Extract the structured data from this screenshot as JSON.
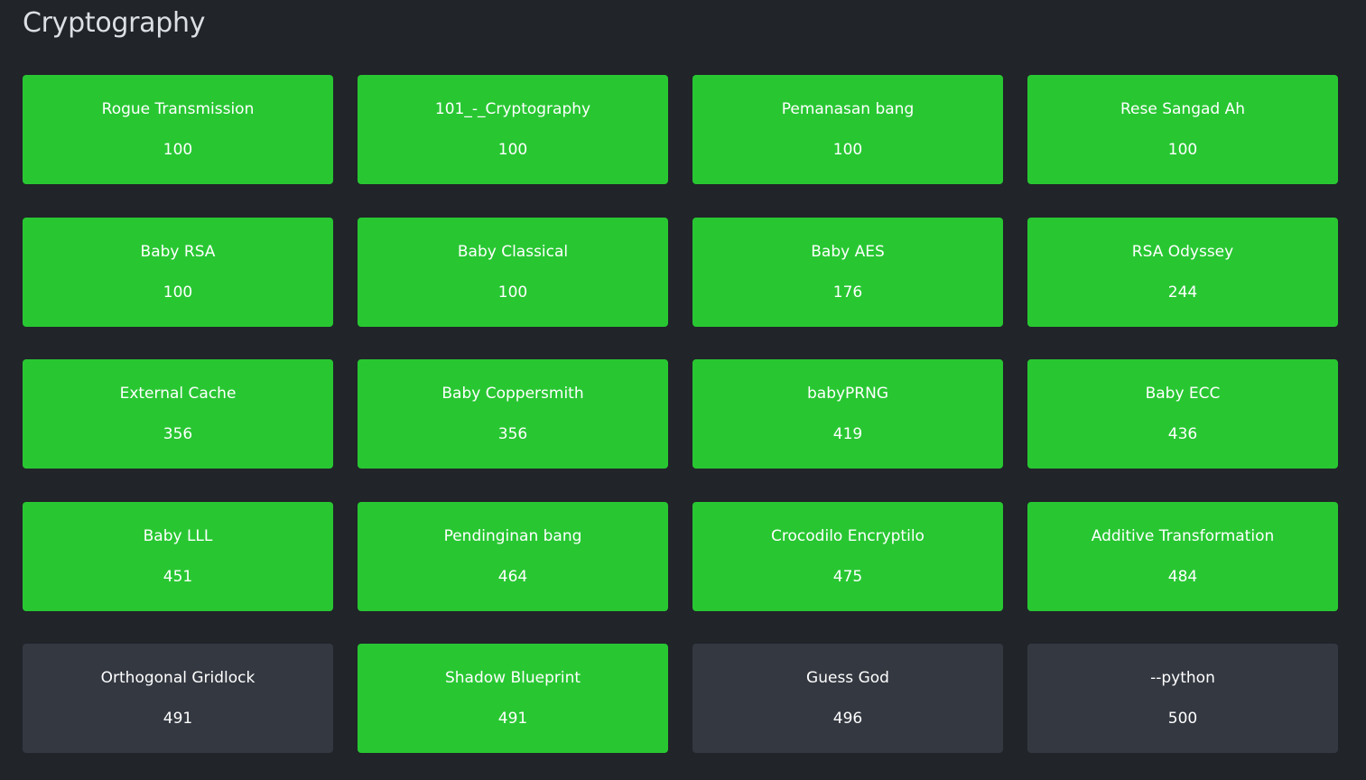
{
  "category": {
    "title": "Cryptography"
  },
  "colors": {
    "background": "#212429",
    "solved": "#28c732",
    "unsolved": "#343841"
  },
  "challenges": [
    {
      "name": "Rogue Transmission",
      "points": "100",
      "solved": true
    },
    {
      "name": "101_-_Cryptography",
      "points": "100",
      "solved": true
    },
    {
      "name": "Pemanasan bang",
      "points": "100",
      "solved": true
    },
    {
      "name": "Rese Sangad Ah",
      "points": "100",
      "solved": true
    },
    {
      "name": "Baby RSA",
      "points": "100",
      "solved": true
    },
    {
      "name": "Baby Classical",
      "points": "100",
      "solved": true
    },
    {
      "name": "Baby AES",
      "points": "176",
      "solved": true
    },
    {
      "name": "RSA Odyssey",
      "points": "244",
      "solved": true
    },
    {
      "name": "External Cache",
      "points": "356",
      "solved": true
    },
    {
      "name": "Baby Coppersmith",
      "points": "356",
      "solved": true
    },
    {
      "name": "babyPRNG",
      "points": "419",
      "solved": true
    },
    {
      "name": "Baby ECC",
      "points": "436",
      "solved": true
    },
    {
      "name": "Baby LLL",
      "points": "451",
      "solved": true
    },
    {
      "name": "Pendinginan bang",
      "points": "464",
      "solved": true
    },
    {
      "name": "Crocodilo Encryptilo",
      "points": "475",
      "solved": true
    },
    {
      "name": "Additive Transformation",
      "points": "484",
      "solved": true
    },
    {
      "name": "Orthogonal Gridlock",
      "points": "491",
      "solved": false
    },
    {
      "name": "Shadow Blueprint",
      "points": "491",
      "solved": true
    },
    {
      "name": "Guess God",
      "points": "496",
      "solved": false
    },
    {
      "name": "--python",
      "points": "500",
      "solved": false
    }
  ]
}
